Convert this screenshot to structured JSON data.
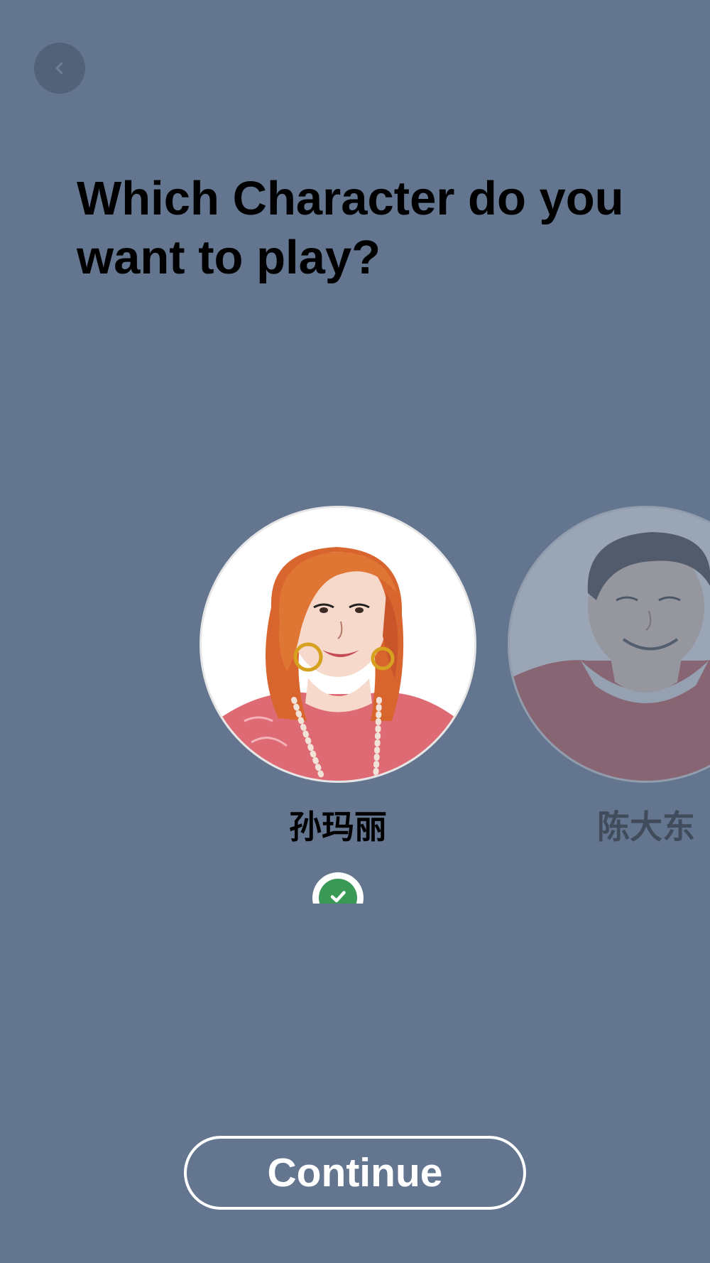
{
  "header": {
    "back_icon": "chevron-left-icon",
    "title": "Which Character do you want to play?"
  },
  "characters": [
    {
      "name": "孙玛丽",
      "selected": true,
      "badge_icon": "check-icon",
      "avatar_icon": "woman-avatar-illustration"
    },
    {
      "name": "陈大东",
      "selected": false,
      "avatar_icon": "man-avatar-illustration"
    }
  ],
  "actions": {
    "continue_label": "Continue"
  },
  "colors": {
    "background": "#64768f",
    "text": "#000000",
    "button_outline": "#ffffff",
    "check_green": "#3a9a55"
  }
}
